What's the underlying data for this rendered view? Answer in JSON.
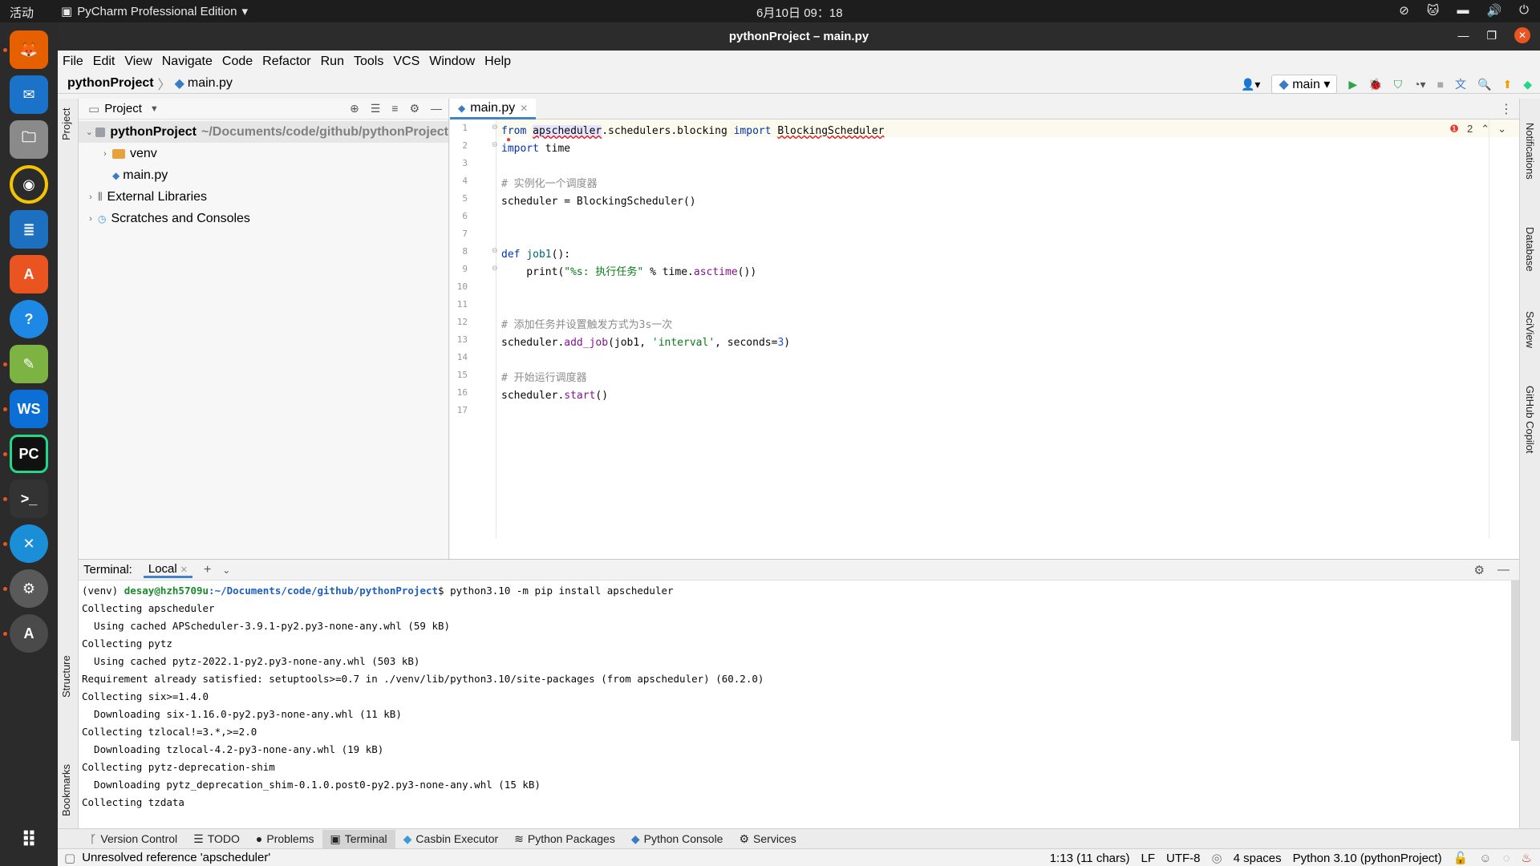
{
  "topbar": {
    "activities": "活动",
    "app_menu": "PyCharm Professional Edition",
    "clock": "6月10日  09：18"
  },
  "window": {
    "title": "pythonProject – main.py"
  },
  "menu": [
    "File",
    "Edit",
    "View",
    "Navigate",
    "Code",
    "Refactor",
    "Run",
    "Tools",
    "VCS",
    "Window",
    "Help"
  ],
  "breadcrumb": {
    "project": "pythonProject",
    "file": "main.py"
  },
  "toolbar": {
    "branch": "main"
  },
  "project_panel": {
    "title": "Project",
    "tree": [
      {
        "label": "pythonProject",
        "path": "~/Documents/code/github/pythonProject",
        "level": 0,
        "expanded": true
      },
      {
        "label": "venv",
        "level": 1,
        "expanded": false
      },
      {
        "label": "main.py",
        "level": 1
      },
      {
        "label": "External Libraries",
        "level": 0,
        "expanded": false
      },
      {
        "label": "Scratches and Consoles",
        "level": 0,
        "expanded": false
      }
    ]
  },
  "editor": {
    "tab": "main.py",
    "error_count": "2",
    "lines": [
      "1",
      "2",
      "3",
      "4",
      "5",
      "6",
      "7",
      "8",
      "9",
      "10",
      "11",
      "12",
      "13",
      "14",
      "15",
      "16",
      "17"
    ],
    "code": {
      "l1_kw_from": "from",
      "l1_mod": "apscheduler",
      "l1_rest": ".schedulers.blocking ",
      "l1_kw_import": "import",
      "l1_cls": "BlockingScheduler",
      "l2_kw": "import",
      "l2_mod": " time",
      "l4": "# 实例化一个调度器",
      "l5_a": "scheduler = BlockingScheduler()",
      "l8_kw": "def ",
      "l8_fn": "job1",
      "l8_rest": "():",
      "l9_a": "    print(",
      "l9_str": "\"%s: 执行任务\"",
      "l9_b": " % time.",
      "l9_m": "asctime",
      "l9_c": "())",
      "l12": "# 添加任务并设置触发方式为3s一次",
      "l13_a": "scheduler.",
      "l13_m": "add_job",
      "l13_b": "(job1, ",
      "l13_str": "'interval'",
      "l13_c": ", seconds=",
      "l13_num": "3",
      "l13_d": ")",
      "l15": "# 开始运行调度器",
      "l16_a": "scheduler.",
      "l16_m": "start",
      "l16_b": "()"
    }
  },
  "terminal": {
    "label": "Terminal:",
    "tab": "Local",
    "prompt_env": "(venv) ",
    "prompt_user": "desay@hzh5709u",
    "prompt_path": ":~/Documents/code/github/pythonProject",
    "prompt_cmd": "$ python3.10 -m pip install apscheduler",
    "output": [
      "Collecting apscheduler",
      "  Using cached APScheduler-3.9.1-py2.py3-none-any.whl (59 kB)",
      "Collecting pytz",
      "  Using cached pytz-2022.1-py2.py3-none-any.whl (503 kB)",
      "Requirement already satisfied: setuptools>=0.7 in ./venv/lib/python3.10/site-packages (from apscheduler) (60.2.0)",
      "Collecting six>=1.4.0",
      "  Downloading six-1.16.0-py2.py3-none-any.whl (11 kB)",
      "Collecting tzlocal!=3.*,>=2.0",
      "  Downloading tzlocal-4.2-py3-none-any.whl (19 kB)",
      "Collecting pytz-deprecation-shim",
      "  Downloading pytz_deprecation_shim-0.1.0.post0-py2.py3-none-any.whl (15 kB)",
      "Collecting tzdata"
    ]
  },
  "tool_tabs": [
    "Version Control",
    "TODO",
    "Problems",
    "Terminal",
    "Casbin Executor",
    "Python Packages",
    "Python Console",
    "Services"
  ],
  "side_labels": {
    "project": "Project",
    "structure": "Structure",
    "bookmarks": "Bookmarks",
    "notifications": "Notifications",
    "database": "Database",
    "sciview": "SciView",
    "copilot": "GitHub Copilot"
  },
  "status": {
    "message": "Unresolved reference 'apscheduler'",
    "position": "1:13 (11 chars)",
    "line_sep": "LF",
    "encoding": "UTF-8",
    "indent": "4 spaces",
    "interpreter": "Python 3.10 (pythonProject)"
  }
}
